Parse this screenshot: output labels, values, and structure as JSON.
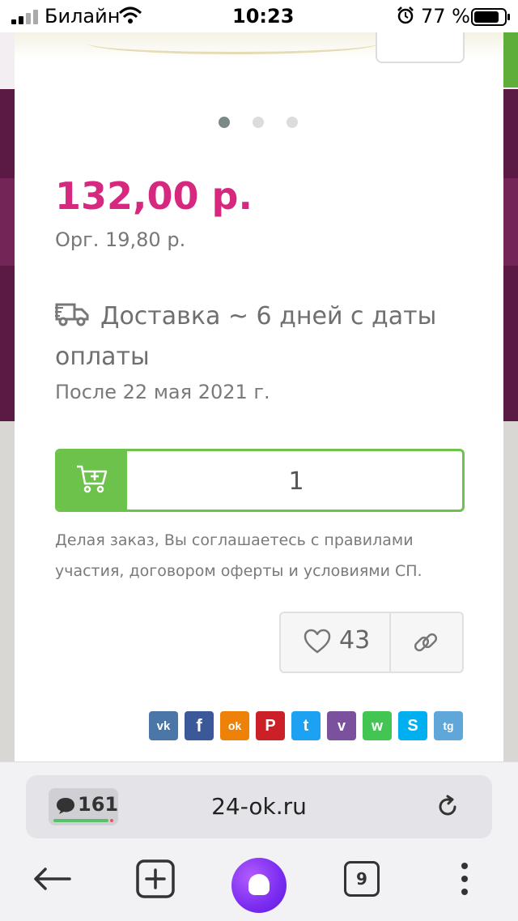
{
  "status_bar": {
    "carrier": "Билайн",
    "time": "10:23",
    "battery": "77 %"
  },
  "carousel": {
    "slides": 3,
    "active_slide": 1
  },
  "product": {
    "price": "132,00 р.",
    "org_fee": "Орг. 19,80 р.",
    "delivery": "Доставка ~ 6 дней с даты оплаты",
    "delivery_date": "После 22 мая 2021 г.",
    "quantity": "1",
    "agreement": "Делая заказ, Вы соглашаетесь с правилами участия, договором оферты и условиями СП.",
    "likes": "43"
  },
  "share": [
    {
      "name": "vk",
      "label": "vk",
      "color": "#4a76a8"
    },
    {
      "name": "facebook",
      "label": "f",
      "color": "#3b5998"
    },
    {
      "name": "odnoklassniki",
      "label": "ok",
      "color": "#ee8208"
    },
    {
      "name": "pinterest",
      "label": "P",
      "color": "#cb2027"
    },
    {
      "name": "twitter",
      "label": "t",
      "color": "#1da1f2"
    },
    {
      "name": "viber",
      "label": "v",
      "color": "#7b519d"
    },
    {
      "name": "whatsapp",
      "label": "w",
      "color": "#43c553"
    },
    {
      "name": "skype",
      "label": "S",
      "color": "#00aff0"
    },
    {
      "name": "telegram",
      "label": "tg",
      "color": "#5fa7d8"
    }
  ],
  "browser": {
    "message_count": "161",
    "url": "24-ok.ru",
    "tab_count": "9"
  },
  "colors": {
    "accent_pink": "#d6287f",
    "accent_green": "#6cc24a"
  }
}
